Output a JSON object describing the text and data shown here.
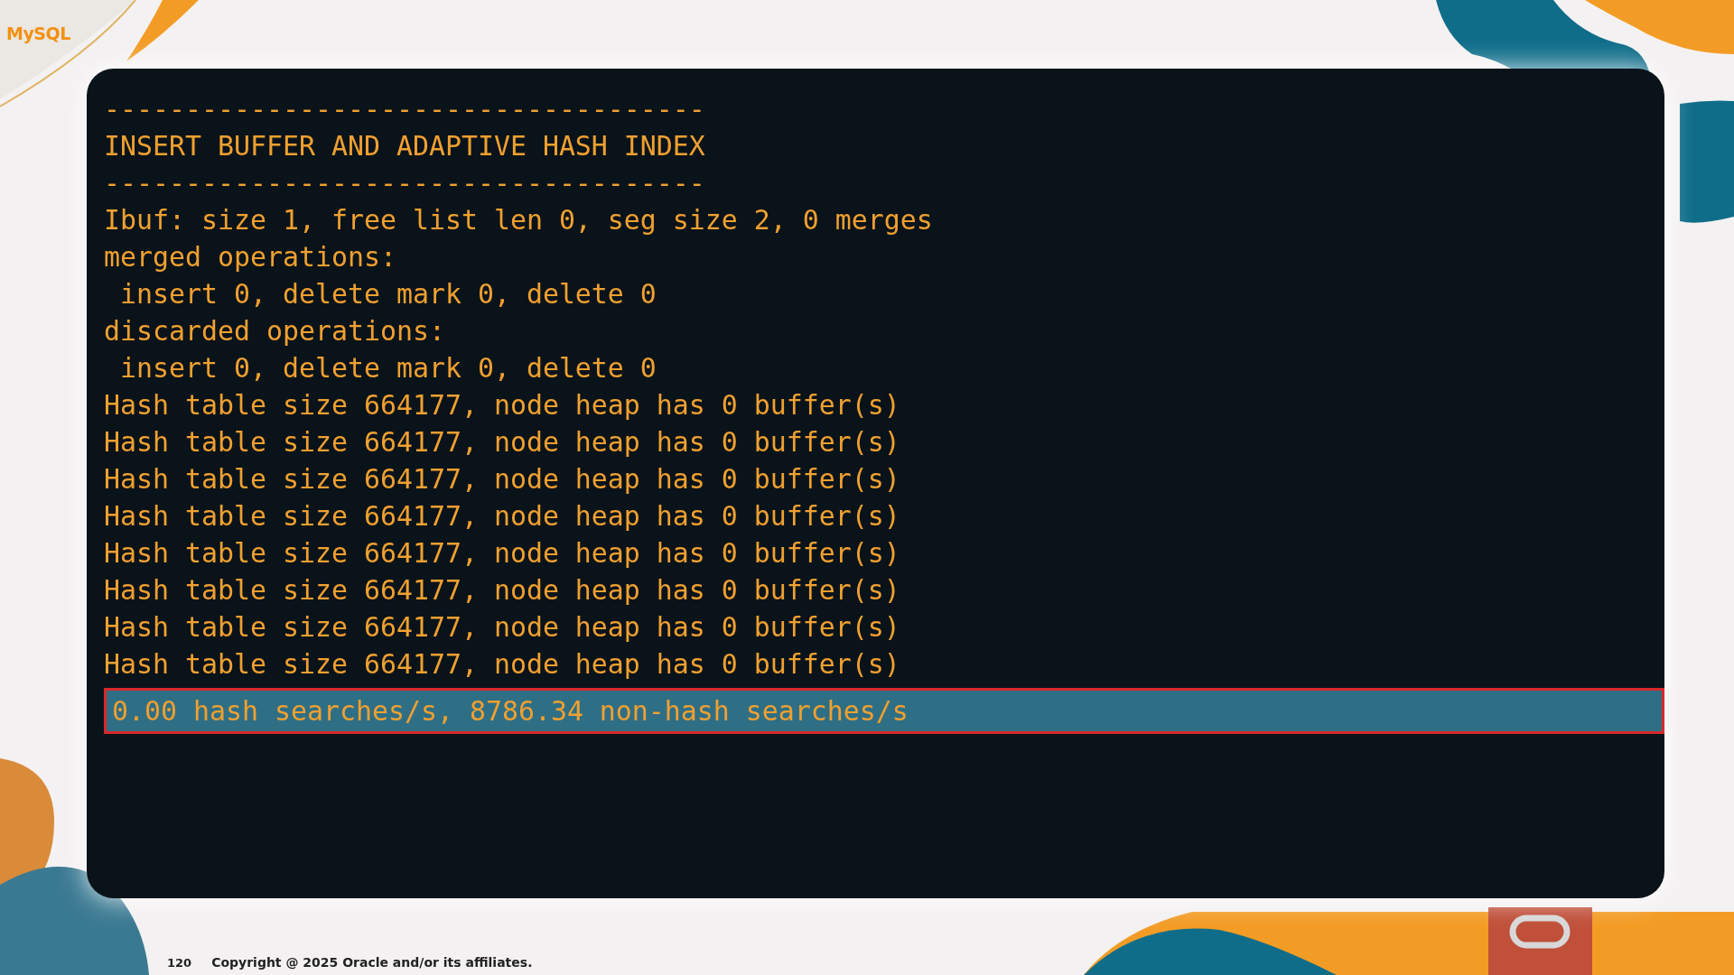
{
  "slide": {
    "logo": "MySQL",
    "page_number": "120",
    "copyright": "Copyright @ 2025 Oracle and/or its affiliates."
  },
  "terminal": {
    "lines": [
      "-------------------------------------",
      "INSERT BUFFER AND ADAPTIVE HASH INDEX",
      "-------------------------------------",
      "Ibuf: size 1, free list len 0, seg size 2, 0 merges",
      "merged operations:",
      " insert 0, delete mark 0, delete 0",
      "discarded operations:",
      " insert 0, delete mark 0, delete 0",
      "Hash table size 664177, node heap has 0 buffer(s)",
      "Hash table size 664177, node heap has 0 buffer(s)",
      "Hash table size 664177, node heap has 0 buffer(s)",
      "Hash table size 664177, node heap has 0 buffer(s)",
      "Hash table size 664177, node heap has 0 buffer(s)",
      "Hash table size 664177, node heap has 0 buffer(s)",
      "Hash table size 664177, node heap has 0 buffer(s)",
      "Hash table size 664177, node heap has 0 buffer(s)"
    ],
    "highlighted_line": "0.00 hash searches/s, 8786.34 non-hash searches/s"
  }
}
